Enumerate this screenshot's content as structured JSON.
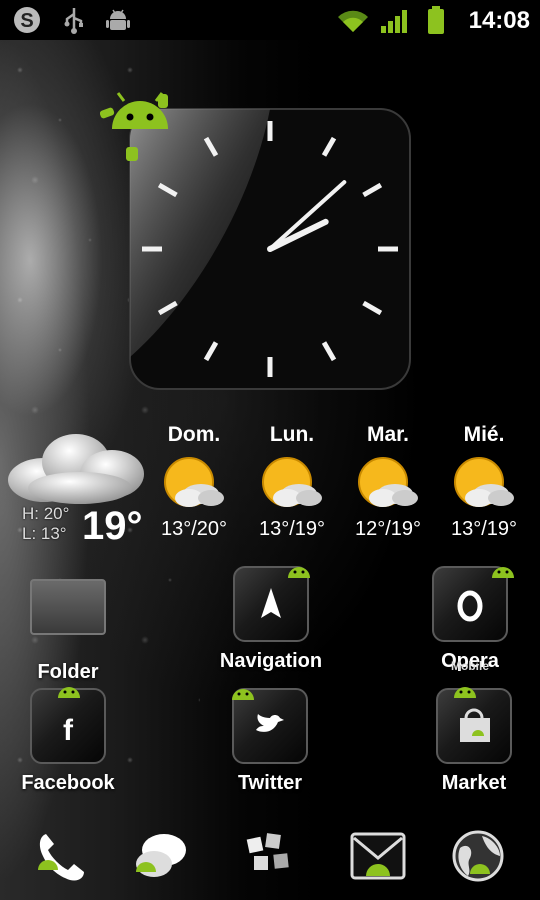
{
  "status_bar": {
    "time": "14:08",
    "icons": [
      "skype-icon",
      "usb-icon",
      "android-debug-icon",
      "wifi-icon",
      "signal-icon",
      "battery-icon"
    ]
  },
  "clock": {
    "hour": 2,
    "minute": 8
  },
  "weather": {
    "current_temp": "19°",
    "high": "H: 20°",
    "low": "L: 13°",
    "forecast": [
      {
        "day": "Dom.",
        "range": "13°/20°",
        "icon": "partly-sunny-icon"
      },
      {
        "day": "Lun.",
        "range": "13°/19°",
        "icon": "partly-sunny-icon"
      },
      {
        "day": "Mar.",
        "range": "12°/19°",
        "icon": "partly-sunny-icon"
      },
      {
        "day": "Mié.",
        "range": "13°/19°",
        "icon": "partly-sunny-icon"
      }
    ]
  },
  "apps": {
    "row1": [
      {
        "label": "Folder",
        "icon": "folder-icon"
      },
      {
        "label": "Navigation",
        "icon": "navigation-icon"
      },
      {
        "label": "Opera",
        "sublabel": "Mobile",
        "icon": "opera-icon"
      }
    ],
    "row2": [
      {
        "label": "Facebook",
        "icon": "facebook-icon"
      },
      {
        "label": "Twitter",
        "icon": "twitter-icon"
      },
      {
        "label": "Market",
        "icon": "market-icon"
      }
    ]
  },
  "dock": [
    "phone-icon",
    "messaging-icon",
    "app-drawer-icon",
    "email-icon",
    "browser-icon"
  ],
  "colors": {
    "android_green": "#8dc21f",
    "background": "#000000"
  }
}
